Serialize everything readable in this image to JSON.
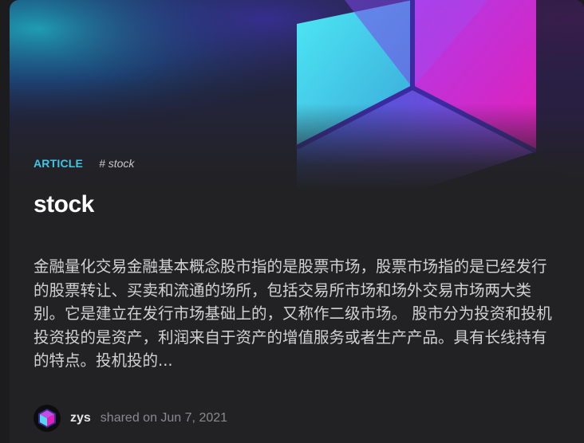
{
  "post": {
    "category": "ARTICLE",
    "tag": "# stock",
    "title": "stock",
    "excerpt": "金融量化交易金融基本概念股市指的是股票市场，股票市场指的是已经发行的股票转让、买卖和流通的场所，包括交易所市场和场外交易市场两大类别。它是建立在发行市场基础上的，又称作二级市场。 股市分为投资和投机投资投的是资产，利润来自于资产的增值服务或者生产产品。具有长线持有的特点。投机投的...",
    "author": "zys",
    "shared": "shared on Jun 7, 2021"
  },
  "colors": {
    "accent": "#3fc7e6",
    "background": "#222224"
  },
  "icons": {
    "cover": "hexagon-logo-cover-image",
    "avatar": "hexagon-logo-avatar"
  }
}
